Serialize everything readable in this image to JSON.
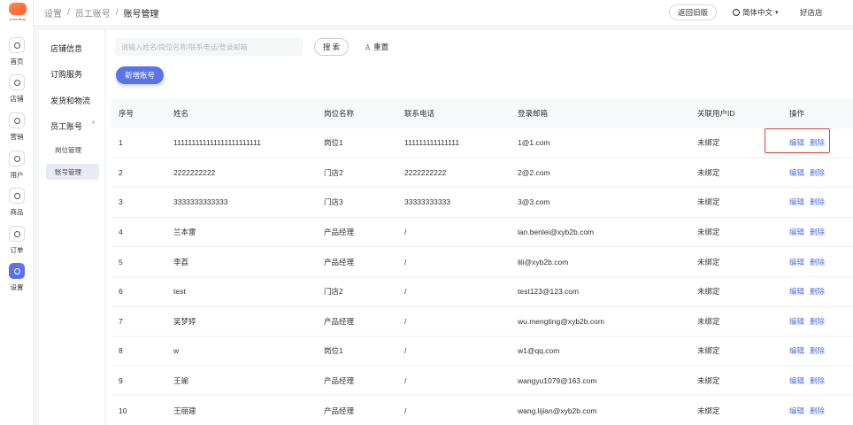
{
  "app": {
    "logo_text": "UnionBuy"
  },
  "rail": [
    {
      "label": "首页",
      "icon": "home-icon"
    },
    {
      "label": "店铺",
      "icon": "store-icon"
    },
    {
      "label": "营销",
      "icon": "marketing-icon"
    },
    {
      "label": "用户",
      "icon": "user-icon"
    },
    {
      "label": "商品",
      "icon": "bag-icon"
    },
    {
      "label": "订单",
      "icon": "order-icon"
    },
    {
      "label": "设置",
      "icon": "settings-icon",
      "active": true
    }
  ],
  "header": {
    "breadcrumb": [
      "设置",
      "员工账号",
      "账号管理"
    ],
    "back_old_label": "返回旧版",
    "language_label": "简体中文",
    "shop_name": "好店店"
  },
  "subnav": {
    "items": [
      "店铺信息",
      "订购服务",
      "发货和物流",
      "员工账号"
    ],
    "children": [
      "岗位管理",
      "账号管理"
    ],
    "active_child": "账号管理"
  },
  "toolbar": {
    "search_placeholder": "请输入姓名/岗位名称/联系电话/登录邮箱",
    "search_label": "搜 索",
    "reset_label": "重置",
    "add_label": "新增账号"
  },
  "table": {
    "columns": [
      "序号",
      "姓名",
      "岗位名称",
      "联系电话",
      "登录邮箱",
      "关联用户ID",
      "操作"
    ],
    "rows": [
      [
        "1",
        "111111111111111111111111",
        "岗位1",
        "111111111111111",
        "1@1.com",
        "未绑定"
      ],
      [
        "2",
        "2222222222",
        "门店2",
        "2222222222",
        "2@2.com",
        "未绑定"
      ],
      [
        "3",
        "3333333333333",
        "门店3",
        "33333333333",
        "3@3.com",
        "未绑定"
      ],
      [
        "4",
        "兰本雷",
        "产品经理",
        "/",
        "lan.benlei@xyb2b.com",
        "未绑定"
      ],
      [
        "5",
        "李荔",
        "产品经理",
        "/",
        "lili@xyb2b.com",
        "未绑定"
      ],
      [
        "6",
        "test",
        "门店2",
        "/",
        "test123@123.com",
        "未绑定"
      ],
      [
        "7",
        "吴梦婷",
        "产品经理",
        "/",
        "wu.mengting@xyb2b.com",
        "未绑定"
      ],
      [
        "8",
        "w",
        "岗位1",
        "/",
        "w1@qq.com",
        "未绑定"
      ],
      [
        "9",
        "王瑜",
        "产品经理",
        "/",
        "wangyu1079@163.com",
        "未绑定"
      ],
      [
        "10",
        "王丽建",
        "产品经理",
        "/",
        "wang.lijian@xyb2b.com",
        "未绑定"
      ]
    ],
    "edit_label": "编辑",
    "delete_label": "删除"
  },
  "colors": {
    "accent": "#5b73e8",
    "link": "#4f6fe0",
    "highlight": "#e0413a"
  }
}
